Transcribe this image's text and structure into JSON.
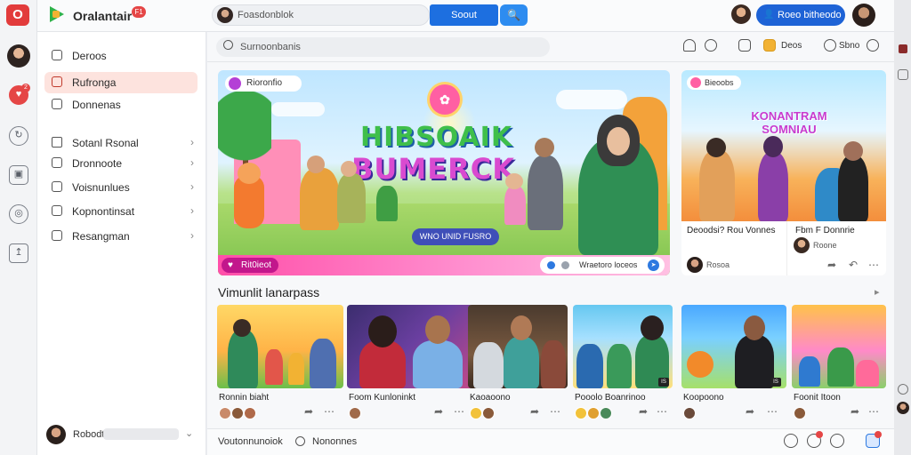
{
  "topbar": {
    "app_name": "Oralantair",
    "app_badge": "F1",
    "search_value": "Foasdonblok",
    "primary_button": "Soout",
    "connect_button": "Roeo bitheodo"
  },
  "rail": {
    "logo": "O",
    "badge": "2"
  },
  "sidebar": {
    "items": [
      {
        "label": "Deroos"
      },
      {
        "label": "Rufronga"
      },
      {
        "label": "Donnenas"
      },
      {
        "label": "Sotanl Rsonal"
      },
      {
        "label": "Dronnoote"
      },
      {
        "label": "Voisnunlues"
      },
      {
        "label": "Kopnontinsat"
      },
      {
        "label": "Resangman"
      }
    ],
    "footer_label": "Robodt"
  },
  "subbar": {
    "search_placeholder": "Surnoonbanis",
    "action_label_1": "Deos",
    "action_label_2": "Sbno"
  },
  "hero": {
    "badge": "Rioronfio",
    "title_line1": "HIBSOAIK",
    "title_line2": "BUMERCK",
    "pill_label": "WNO UNID FUSRO",
    "tag_label": "Rit0ieot",
    "card_label": "Wraetoro loceos"
  },
  "side_card": {
    "pill": "Bieoobs",
    "title": "KONANTRAM SOMNIAU",
    "row_left": "Deoodsi? Rou Vonnes",
    "row_right": "Fbm F Donnrie",
    "meta_left": "Rosoa",
    "meta_right": "Roone"
  },
  "section": {
    "title": "Vimunlit lanarpass"
  },
  "videos": [
    {
      "title": "Ronnin biaht",
      "badge": ""
    },
    {
      "title": "Foom Kunloninkt",
      "badge": ""
    },
    {
      "title": "Kaoaoono",
      "badge": ""
    },
    {
      "title": "Pooolo Boanrinoo",
      "badge": "IS"
    },
    {
      "title": "Koopoono",
      "badge": "IS"
    },
    {
      "title": "Foonit Itoon",
      "badge": ""
    }
  ],
  "bottombar": {
    "text_left": "Voutonnunoiok",
    "text_right": "Nononnes"
  },
  "colors": {
    "primary_blue": "#1d6fe0",
    "accent_red": "#e54646",
    "active_sidebar_bg": "#fde3de"
  }
}
